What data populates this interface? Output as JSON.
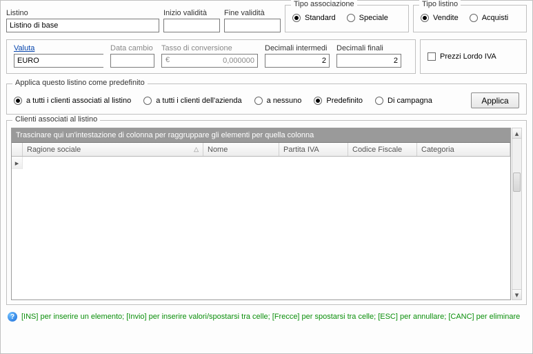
{
  "top": {
    "listino_label": "Listino",
    "listino_value": "Listino di base",
    "inizio_label": "Inizio validità",
    "inizio_value": "",
    "fine_label": "Fine validità",
    "fine_value": ""
  },
  "tipo_associazione": {
    "legend": "Tipo associazione",
    "standard": "Standard",
    "speciale": "Speciale",
    "selected": "standard"
  },
  "tipo_listino": {
    "legend": "Tipo listino",
    "vendite": "Vendite",
    "acquisti": "Acquisti",
    "selected": "vendite"
  },
  "currency": {
    "valuta_label": "Valuta",
    "valuta_value": "EURO",
    "data_cambio_label": "Data cambio",
    "data_cambio_value": "",
    "tasso_label": "Tasso di conversione",
    "tasso_value": "0,000000",
    "euro_symbol": "€",
    "dec_int_label": "Decimali intermedi",
    "dec_int_value": "2",
    "dec_fin_label": "Decimali finali",
    "dec_fin_value": "2"
  },
  "prezzi_lordo": {
    "label": "Prezzi Lordo IVA",
    "checked": false
  },
  "predef": {
    "legend": "Applica questo listino come predefinito",
    "opt_tutti_assoc": "a tutti i clienti associati al listino",
    "opt_tutti_azienda": "a tutti i clienti dell'azienda",
    "opt_nessuno": "a nessuno",
    "opt_predefinito": "Predefinito",
    "opt_campagna": "Di campagna",
    "selected_left": "tutti_assoc",
    "selected_right": "predefinito",
    "applica_btn": "Applica"
  },
  "grid": {
    "legend": "Clienti associati al listino",
    "group_hint": "Trascinare qui un'intestazione di colonna per raggruppare gli elementi per quella colonna",
    "columns": {
      "ragione": "Ragione sociale",
      "nome": "Nome",
      "piva": "Partita IVA",
      "cf": "Codice Fiscale",
      "categoria": "Categoria"
    },
    "row_indicator": "▸"
  },
  "help": {
    "text": "[INS] per inserire un elemento; [Invio] per inserire valori/spostarsi tra celle; [Frecce] per spostarsi tra celle; [ESC] per annullare; [CANC] per eliminare"
  },
  "scroll_glyphs": {
    "up": "▴",
    "down": "▾"
  }
}
